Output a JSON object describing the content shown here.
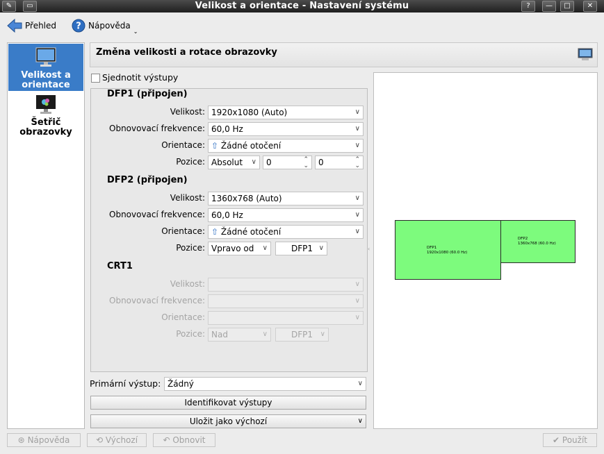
{
  "window": {
    "title": "Velikost a orientace - Nastavení systému"
  },
  "toolbar": {
    "overview_label": "Přehled",
    "help_label": "Nápověda"
  },
  "sidebar": {
    "items": [
      {
        "label_line1": "Velikost a",
        "label_line2": "orientace",
        "icon": "monitor-icon"
      },
      {
        "label_line1": "Šetřič",
        "label_line2": "obrazovky",
        "icon": "screensaver-monitor-icon"
      }
    ]
  },
  "header": {
    "title": "Změna velikosti a rotace obrazovky"
  },
  "unify": {
    "label": "Sjednotit výstupy",
    "checked": false
  },
  "labels": {
    "size": "Velikost:",
    "refresh": "Obnovovací frekvence:",
    "orientation": "Orientace:",
    "position": "Pozice:"
  },
  "outputs": {
    "dfp1": {
      "title": "DFP1 (připojen)",
      "size": "1920x1080 (Auto)",
      "refresh": "60,0 Hz",
      "orientation": "Žádné otočení",
      "position_mode": "Absolut",
      "pos_x": "0",
      "pos_y": "0"
    },
    "dfp2": {
      "title": "DFP2 (připojen)",
      "size": "1360x768 (Auto)",
      "refresh": "60,0 Hz",
      "orientation": "Žádné otočení",
      "position_mode": "Vpravo od",
      "position_ref": "DFP1"
    },
    "crt1": {
      "title": "CRT1",
      "position_mode": "Nad",
      "position_ref": "DFP1"
    }
  },
  "primary": {
    "label": "Primární výstup:",
    "value": "Žádný"
  },
  "buttons": {
    "identify": "Identifikovat výstupy",
    "save_default": "Uložit jako výchozí",
    "help": "Nápověda",
    "defaults": "Výchozí",
    "reset": "Obnovit",
    "apply": "Použít"
  },
  "preview": {
    "dfp1": {
      "name": "DFP1",
      "mode": "1920x1080 (60.0 Hz)"
    },
    "dfp2": {
      "name": "DFP2",
      "mode": "1360x768 (60.0 Hz)"
    },
    "monitor_color": "#7dfb7d"
  },
  "colors": {
    "selection": "#3a7cc8"
  }
}
